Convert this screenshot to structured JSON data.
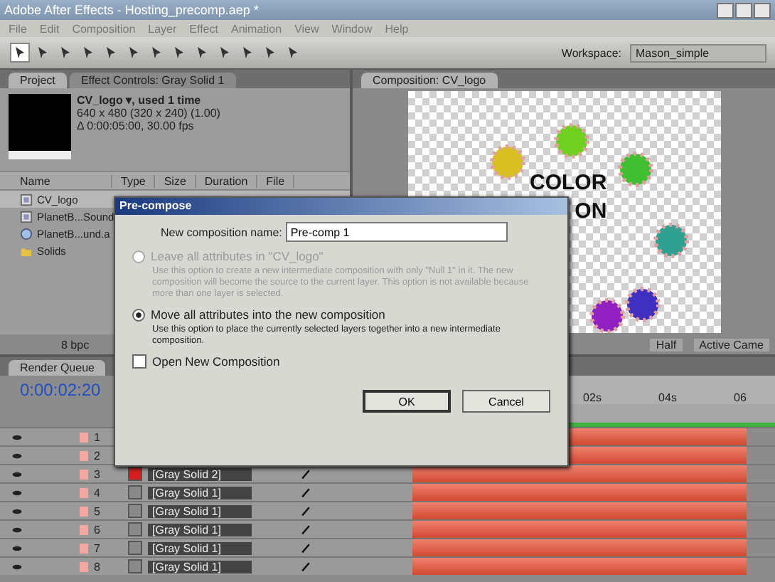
{
  "window": {
    "title": "Adobe After Effects - Hosting_precomp.aep *"
  },
  "menu": [
    "File",
    "Edit",
    "Composition",
    "Layer",
    "Effect",
    "Animation",
    "View",
    "Window",
    "Help"
  ],
  "workspace": {
    "label": "Workspace:",
    "value": "Mason_simple"
  },
  "project_panel": {
    "tabs": [
      {
        "label": "Project",
        "selected": true
      },
      {
        "label": "Effect Controls: Gray Solid 1",
        "selected": false
      }
    ],
    "info": [
      "CV_logo ▾, used 1 time",
      "640 x 480  (320 x 240) (1.00)",
      "Δ 0:00:05:00, 30.00 fps"
    ],
    "columns": [
      "Name",
      "Type",
      "Size",
      "Duration",
      "File"
    ],
    "items": [
      {
        "name": "CV_logo",
        "kind": "comp",
        "selected": true
      },
      {
        "name": "PlanetB...Sound",
        "kind": "comp",
        "selected": false
      },
      {
        "name": "PlanetB...und.a",
        "kind": "audio",
        "selected": false
      },
      {
        "name": "Solids",
        "kind": "folder",
        "selected": false
      }
    ],
    "bpc": "8 bpc"
  },
  "composition_panel": {
    "tab": "Composition: CV_logo",
    "texts": [
      "COLOR",
      "ON"
    ],
    "resolution": "Half",
    "camera": "Active Came"
  },
  "timeline": {
    "tab": "Render Queue",
    "time": "0:00:02:20",
    "ruler": [
      "02s",
      "04s",
      "06"
    ],
    "layers": [
      {
        "number": "1"
      },
      {
        "number": "2"
      },
      {
        "number": "3",
        "name": "[Gray Solid 2]",
        "color": "#d42020"
      },
      {
        "number": "4",
        "name": "[Gray Solid 1]",
        "color": "#8a8a8a"
      },
      {
        "number": "5",
        "name": "[Gray Solid 1]",
        "color": "#8a8a8a"
      },
      {
        "number": "6",
        "name": "[Gray Solid 1]",
        "color": "#8a8a8a"
      },
      {
        "number": "7",
        "name": "[Gray Solid 1]",
        "color": "#8a8a8a"
      },
      {
        "number": "8",
        "name": "[Gray Solid 1]",
        "color": "#8a8a8a"
      }
    ]
  },
  "dialog": {
    "title": "Pre-compose",
    "name_label": "New composition name:",
    "name_value": "Pre-comp 1",
    "options": [
      {
        "label": "Leave all attributes in \"CV_logo\"",
        "description": "Use this option to create a new intermediate composition with only \"Null 1\" in it.  The new composition will become the source to the current layer.  This option is not available because more than one layer is selected.",
        "selected": false,
        "disabled": true
      },
      {
        "label": "Move all attributes into the new composition",
        "description": "Use this option to place the currently selected layers together into a new intermediate composition.",
        "selected": true,
        "disabled": false
      }
    ],
    "open_new": {
      "label": "Open New Composition",
      "checked": false
    },
    "buttons": [
      "OK",
      "Cancel"
    ]
  }
}
